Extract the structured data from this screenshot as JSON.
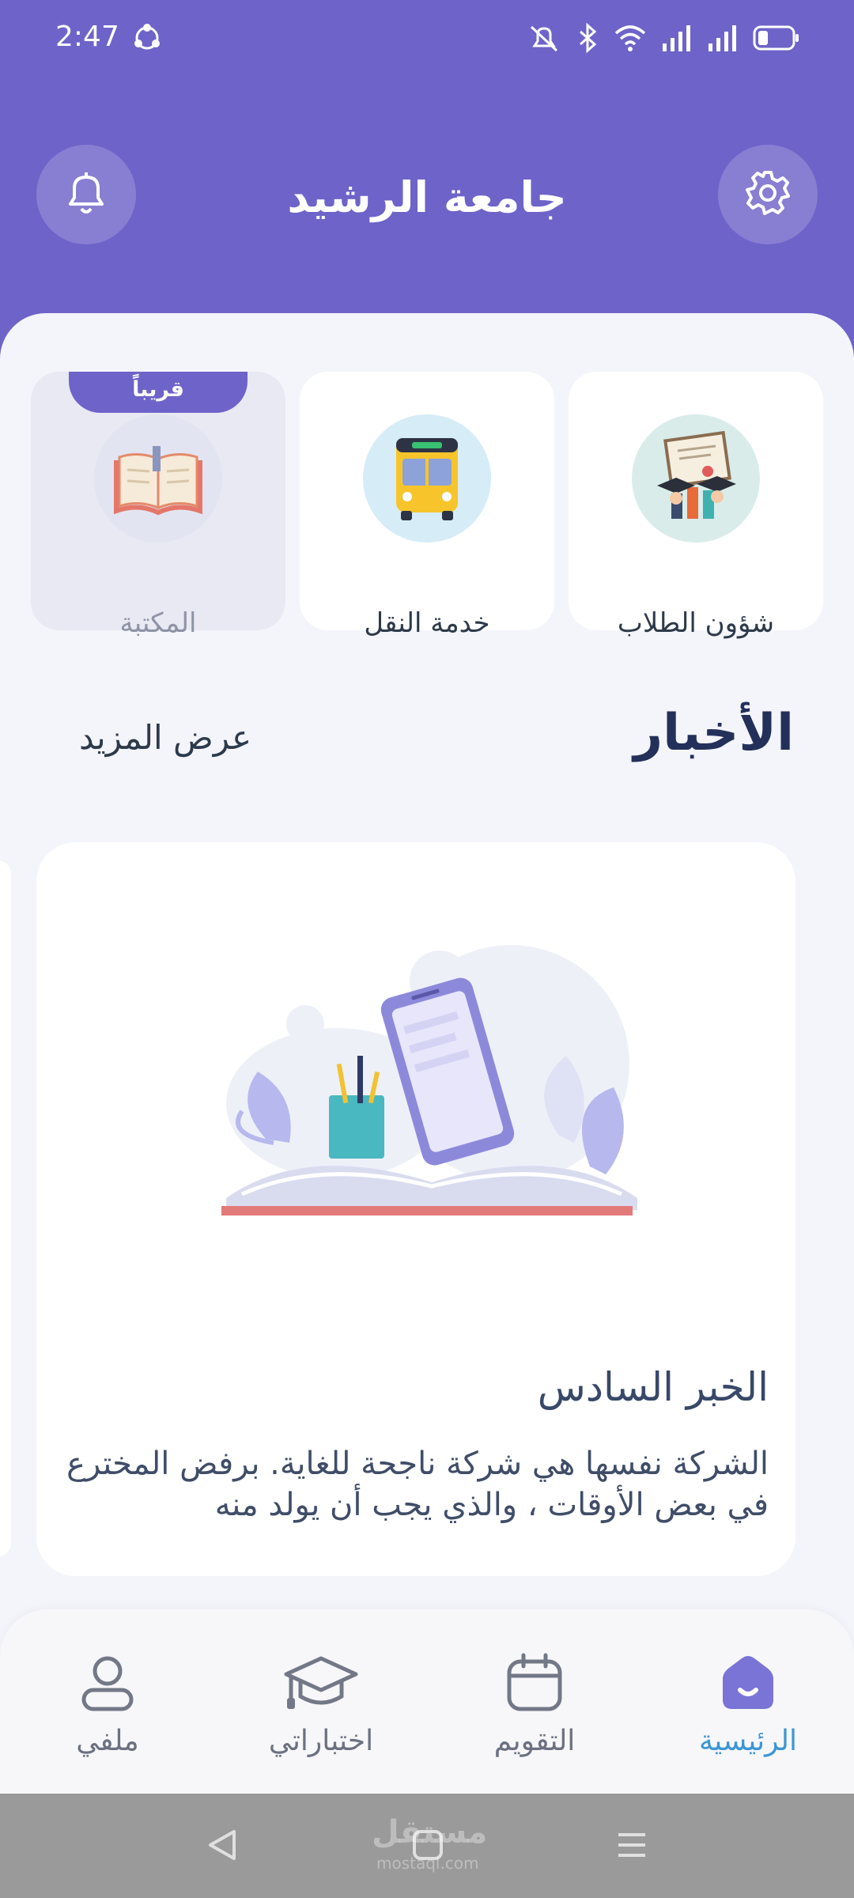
{
  "status_bar": {
    "time": "2:47",
    "icons": [
      "sync-icon",
      "mute-icon",
      "bluetooth-icon",
      "wifi-icon",
      "signal-icon",
      "signal-icon",
      "battery-icon"
    ]
  },
  "header": {
    "title": "جامعة الرشيد",
    "left_button_icon": "bell-icon",
    "right_button_icon": "gear-icon",
    "background": "#6e63c9"
  },
  "services": [
    {
      "label": "شؤون الطلاب",
      "icon": "graduation-certificate-icon"
    },
    {
      "label": "خدمة النقل",
      "icon": "bus-icon"
    },
    {
      "label": "المكتبة",
      "icon": "book-icon",
      "badge": "قريباً",
      "disabled": true
    }
  ],
  "news": {
    "title": "الأخبار",
    "view_more": "عرض المزيد",
    "items": [
      {
        "headline": "الخبر السادس",
        "body": "الشركة نفسها هي شركة ناجحة للغاية. برفض المخترع في بعض الأوقات ، والذي يجب أن يولد منه"
      }
    ]
  },
  "bottom_nav": {
    "items": [
      {
        "label": "الرئيسية",
        "icon": "home-icon",
        "active": true
      },
      {
        "label": "التقويم",
        "icon": "calendar-icon"
      },
      {
        "label": "اختباراتي",
        "icon": "graduation-cap-icon"
      },
      {
        "label": "ملفي",
        "icon": "profile-icon"
      }
    ],
    "active_color": "#3d96d4"
  },
  "system_nav": {
    "watermark": "مستقل",
    "watermark_sub": "mostaql.com"
  }
}
